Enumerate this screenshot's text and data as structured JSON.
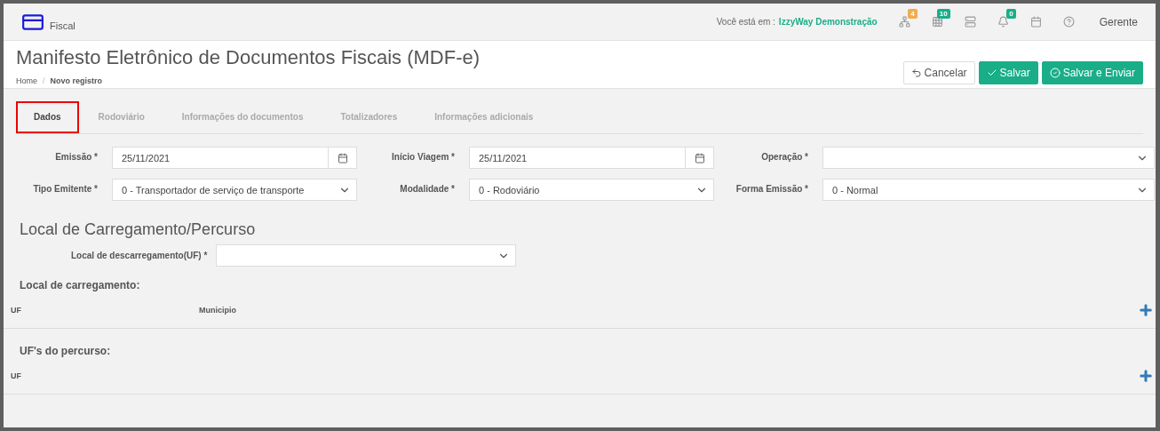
{
  "topbar": {
    "module": "Fiscal",
    "context_label": "Você está em :",
    "context_value": "IzzyWay Demonstração",
    "icons": [
      {
        "kind": "sitemap",
        "badge": "4",
        "color": "#f0ad4e"
      },
      {
        "kind": "grid",
        "badge": "10",
        "color": "#1aae88"
      },
      {
        "kind": "server"
      },
      {
        "kind": "bell",
        "badge": "0",
        "color": "#1aae88"
      },
      {
        "kind": "calendar"
      },
      {
        "kind": "help"
      }
    ],
    "user": "Gerente"
  },
  "header": {
    "title": "Manifesto Eletrônico de Documentos Fiscais (MDF-e)",
    "breadcrumb": [
      "Home",
      "Novo registro"
    ],
    "breadcrumb_separator": "/",
    "buttons": [
      {
        "kind": "cancel",
        "label": "Cancelar"
      },
      {
        "kind": "save",
        "label": "Salvar"
      },
      {
        "kind": "send",
        "label": "Salvar e Enviar"
      }
    ]
  },
  "tabs": [
    {
      "label": "Dados",
      "selected": true
    },
    {
      "label": "Rodoviário",
      "selected": false
    },
    {
      "label": "Informações do documentos",
      "selected": false
    },
    {
      "label": "Totalizadores",
      "selected": false
    },
    {
      "label": "Informações adicionais",
      "selected": false
    }
  ],
  "fields": [
    {
      "label": "Emissão *",
      "kind": "date",
      "value": "25/11/2021"
    },
    {
      "label": "Início Viagem *",
      "kind": "date",
      "value": "25/11/2021"
    },
    {
      "label": "Operação *",
      "kind": "select"
    },
    {
      "label": "Tipo Emitente *",
      "kind": "select",
      "value": "0 - Transportador de serviço de transporte"
    },
    {
      "label": "Modalidade *",
      "kind": "select",
      "value": "0 - Rodoviário"
    },
    {
      "label": "Forma Emissão *",
      "kind": "select",
      "value": "0 - Normal"
    }
  ],
  "section": {
    "title": "Local de Carregamento/Percurso",
    "unload_label": "Local de descarregamento(UF) *"
  },
  "tables": [
    {
      "title": "Local de carregamento:",
      "columns": [
        "UF",
        "Municipio"
      ]
    },
    {
      "title": "UF's do percurso:",
      "columns": [
        "UF"
      ]
    }
  ]
}
